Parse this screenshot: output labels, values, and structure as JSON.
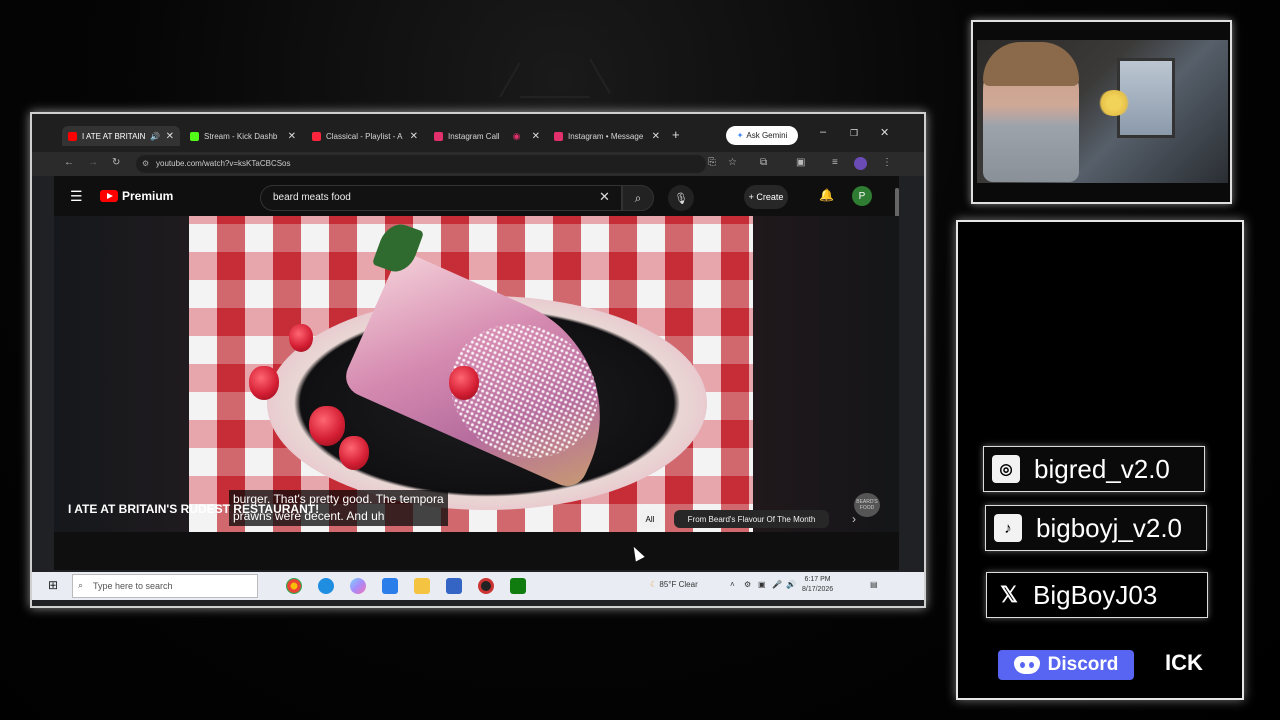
{
  "browser": {
    "tabs": [
      {
        "label": "I ATE AT BRITAIN",
        "color": "#ff0000",
        "active": true
      },
      {
        "label": "Stream - Kick Dashb",
        "color": "#53fc18"
      },
      {
        "label": "Classical - Playlist - A",
        "color": "#fa243c"
      },
      {
        "label": "Instagram Call",
        "color": "#e1306c"
      },
      {
        "label": "Instagram • Message",
        "color": "#e1306c"
      }
    ],
    "gemini_label": "Ask Gemini",
    "url": "youtube.com/watch?v=ksKTaCBCSos"
  },
  "youtube": {
    "brand": "Premium",
    "search_value": "beard meats food",
    "create_label": "Create",
    "profile_initial": "P",
    "subtitle_line1": "burger. That's pretty good. The tempora",
    "subtitle_line2": "prawns were decent. And uh",
    "watermark": "BEARD'S FOOD",
    "video_title": "I ATE AT BRITAIN'S RUDEST RESTAURANT!",
    "chips": [
      "All",
      "From Beard's Flavour Of The Month"
    ]
  },
  "taskbar": {
    "search_placeholder": "Type here to search",
    "weather": "85°F Clear",
    "time": "6:17 PM",
    "date": "8/17/2026"
  },
  "socials": [
    {
      "platform": "instagram-icon",
      "handle": "bigred_v2.0"
    },
    {
      "platform": "tiktok-icon",
      "handle": "bigboyj_v2.0"
    },
    {
      "platform": "x-icon",
      "handle": "BigBoyJ03"
    }
  ],
  "discord_label": "Discord",
  "ick_label": "ICK",
  "colors": {
    "accent": "#ff0000",
    "discord": "#5865f2",
    "profile": "#2e7d32"
  }
}
